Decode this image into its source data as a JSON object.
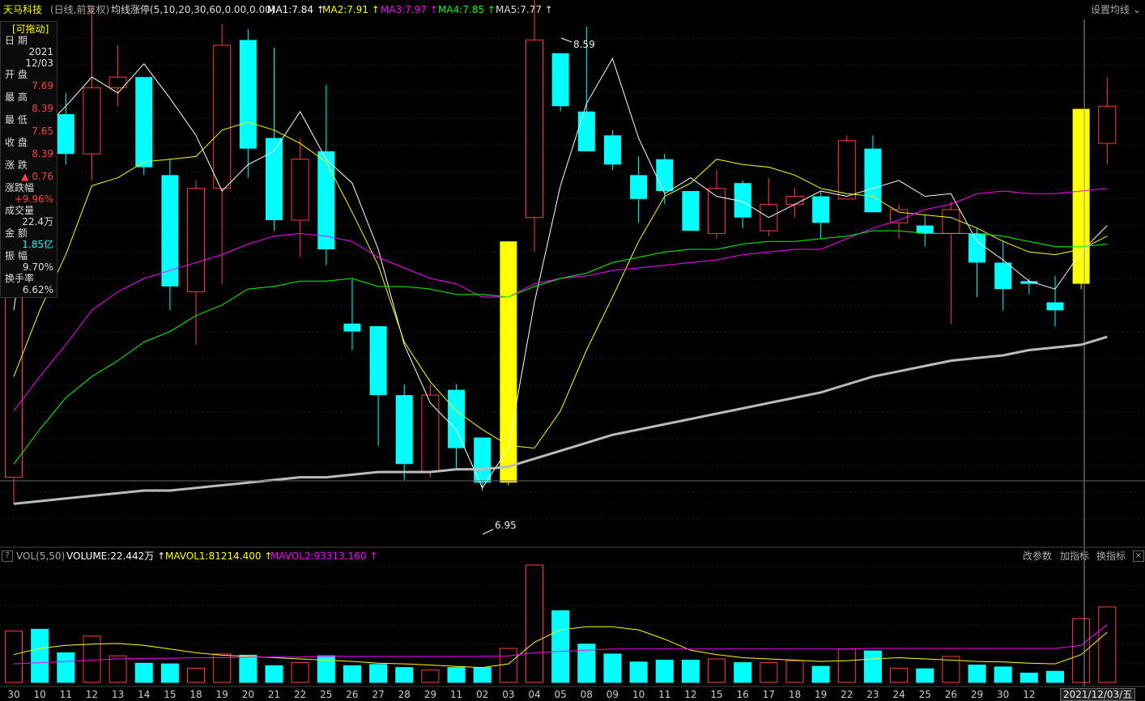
{
  "header": {
    "stock_name": "天马科技",
    "mode": "(日线,前复权)",
    "indicator_name": "均线涨停(5,10,20,30,60,0.00,0.00)",
    "ma1": "MA1:7.84",
    "ma2": "MA2:7.91",
    "ma3": "MA3:7.97",
    "ma4": "MA4:7.85",
    "ma5": "MA5:7.77",
    "settings_label": "设置均线"
  },
  "info_panel": {
    "drag_label": "[可拖动]",
    "date_label": "日 期",
    "year": "2021",
    "date": "12/03",
    "open_label": "开 盘",
    "open": "7.69",
    "high_label": "最 高",
    "high": "8.39",
    "low_label": "最 低",
    "low": "7.65",
    "close_label": "收 盘",
    "close": "8.39",
    "change_label": "涨 跌",
    "change": "▲ 0.76",
    "pct_label": "涨跌幅",
    "pct": "+9.96%",
    "volume_label": "成交量",
    "volume": "22.4万",
    "amount_label": "金 额",
    "amount": "1.85亿",
    "amplitude_label": "振 幅",
    "amplitude": "9.70%",
    "turnover_label": "换手率",
    "turnover": "6.62%"
  },
  "annotations": {
    "high_label": "8.59",
    "low_label": "6.95"
  },
  "volume_panel": {
    "help": "?",
    "name": "VOL(5,50)",
    "volume": "VOLUME:22.442万",
    "mavol1": "MAVOL1:81214.400",
    "mavol2": "MAVOL2:93313.160",
    "buttons": [
      "改参数",
      "加指标",
      "换指标"
    ]
  },
  "x_axis": {
    "labels": [
      "30",
      "10",
      "11",
      "12",
      "13",
      "14",
      "15",
      "18",
      "19",
      "20",
      "21",
      "22",
      "25",
      "26",
      "27",
      "28",
      "29",
      "11",
      "02",
      "03",
      "04",
      "05",
      "08",
      "09",
      "10",
      "11",
      "12",
      "15",
      "16",
      "17",
      "18",
      "19",
      "22",
      "23",
      "24",
      "25",
      "26",
      "29",
      "30",
      "12"
    ],
    "cursor_date": "2021/12/03/五"
  },
  "colors": {
    "up": "#ff3b3b",
    "down": "#00ffff",
    "limit_up": "#ffff00",
    "ma1": "#ffffff",
    "ma2": "#ffff00",
    "ma3": "#ff00ff",
    "ma4": "#00ff00",
    "ma5": "#bbbbbb",
    "background": "#000000"
  },
  "chart_data": {
    "type": "candlestick",
    "candles": [
      {
        "d": "30",
        "o": 7.0,
        "h": 8.6,
        "l": 6.9,
        "c": 8.55,
        "v": 83000,
        "lim": false
      },
      {
        "d": "10",
        "o": 8.5,
        "h": 8.52,
        "l": 8.2,
        "c": 8.3,
        "v": 86000,
        "lim": false
      },
      {
        "d": "11",
        "o": 8.37,
        "h": 8.45,
        "l": 8.18,
        "c": 8.22,
        "v": 48000,
        "lim": false
      },
      {
        "d": "12",
        "o": 8.22,
        "h": 8.78,
        "l": 8.12,
        "c": 8.47,
        "v": 75000,
        "lim": false
      },
      {
        "d": "13",
        "o": 8.47,
        "h": 8.63,
        "l": 8.4,
        "c": 8.51,
        "v": 43000,
        "lim": false
      },
      {
        "d": "14",
        "o": 8.51,
        "h": 8.51,
        "l": 8.14,
        "c": 8.17,
        "v": 31000,
        "lim": false
      },
      {
        "d": "15",
        "o": 8.14,
        "h": 8.2,
        "l": 7.63,
        "c": 7.72,
        "v": 30000,
        "lim": false
      },
      {
        "d": "18",
        "o": 7.7,
        "h": 8.12,
        "l": 7.5,
        "c": 8.09,
        "v": 23000,
        "lim": false
      },
      {
        "d": "19",
        "o": 8.09,
        "h": 8.71,
        "l": 7.73,
        "c": 8.63,
        "v": 46000,
        "lim": false
      },
      {
        "d": "20",
        "o": 8.65,
        "h": 8.69,
        "l": 8.13,
        "c": 8.24,
        "v": 44000,
        "lim": false
      },
      {
        "d": "21",
        "o": 8.28,
        "h": 8.62,
        "l": 7.93,
        "c": 7.97,
        "v": 27000,
        "lim": false
      },
      {
        "d": "22",
        "o": 7.97,
        "h": 8.28,
        "l": 7.83,
        "c": 8.2,
        "v": 32000,
        "lim": false
      },
      {
        "d": "25",
        "o": 8.23,
        "h": 8.48,
        "l": 7.8,
        "c": 7.86,
        "v": 43000,
        "lim": false
      },
      {
        "d": "26",
        "o": 7.58,
        "h": 7.75,
        "l": 7.48,
        "c": 7.55,
        "v": 27000,
        "lim": false
      },
      {
        "d": "27",
        "o": 7.57,
        "h": 7.57,
        "l": 7.12,
        "c": 7.31,
        "v": 29000,
        "lim": false
      },
      {
        "d": "28",
        "o": 7.31,
        "h": 7.35,
        "l": 6.99,
        "c": 7.05,
        "v": 24000,
        "lim": false
      },
      {
        "d": "29",
        "o": 7.02,
        "h": 7.35,
        "l": 7.0,
        "c": 7.31,
        "v": 20000,
        "lim": false
      },
      {
        "d": "11",
        "o": 7.33,
        "h": 7.35,
        "l": 7.03,
        "c": 7.11,
        "v": 24000,
        "lim": false
      },
      {
        "d": "02",
        "o": 7.15,
        "h": 7.15,
        "l": 6.95,
        "c": 6.98,
        "v": 24000,
        "lim": false
      },
      {
        "d": "03",
        "o": 6.98,
        "h": 7.89,
        "l": 6.97,
        "c": 7.89,
        "v": 55000,
        "lim": true
      },
      {
        "d": "04",
        "o": 7.98,
        "h": 8.83,
        "l": 7.85,
        "c": 8.65,
        "v": 190000,
        "lim": false
      },
      {
        "d": "05",
        "o": 8.6,
        "h": 8.59,
        "l": 8.38,
        "c": 8.4,
        "v": 116000,
        "lim": false
      },
      {
        "d": "08",
        "o": 8.38,
        "h": 8.7,
        "l": 8.23,
        "c": 8.23,
        "v": 62000,
        "lim": false
      },
      {
        "d": "09",
        "o": 8.29,
        "h": 8.31,
        "l": 8.16,
        "c": 8.18,
        "v": 46000,
        "lim": false
      },
      {
        "d": "10",
        "o": 8.14,
        "h": 8.21,
        "l": 7.96,
        "c": 8.05,
        "v": 33000,
        "lim": false
      },
      {
        "d": "11",
        "o": 8.2,
        "h": 8.22,
        "l": 8.03,
        "c": 8.08,
        "v": 36000,
        "lim": false
      },
      {
        "d": "12",
        "o": 8.08,
        "h": 8.08,
        "l": 7.93,
        "c": 7.93,
        "v": 36000,
        "lim": false
      },
      {
        "d": "15",
        "o": 7.92,
        "h": 8.16,
        "l": 7.9,
        "c": 8.09,
        "v": 38000,
        "lim": false
      },
      {
        "d": "16",
        "o": 8.11,
        "h": 8.12,
        "l": 7.94,
        "c": 7.98,
        "v": 32000,
        "lim": false
      },
      {
        "d": "17",
        "o": 7.93,
        "h": 8.13,
        "l": 7.91,
        "c": 8.03,
        "v": 32000,
        "lim": false
      },
      {
        "d": "18",
        "o": 8.03,
        "h": 8.09,
        "l": 7.98,
        "c": 8.06,
        "v": 35000,
        "lim": false
      },
      {
        "d": "19",
        "o": 8.06,
        "h": 8.08,
        "l": 7.9,
        "c": 7.96,
        "v": 26000,
        "lim": false
      },
      {
        "d": "22",
        "o": 8.05,
        "h": 8.29,
        "l": 8.05,
        "c": 8.27,
        "v": 54000,
        "lim": false
      },
      {
        "d": "23",
        "o": 8.24,
        "h": 8.29,
        "l": 8.0,
        "c": 8.0,
        "v": 51000,
        "lim": false
      },
      {
        "d": "24",
        "o": 7.96,
        "h": 8.03,
        "l": 7.9,
        "c": 8.01,
        "v": 23000,
        "lim": false
      },
      {
        "d": "25",
        "o": 7.95,
        "h": 7.99,
        "l": 7.87,
        "c": 7.92,
        "v": 22000,
        "lim": false
      },
      {
        "d": "26",
        "o": 7.92,
        "h": 8.04,
        "l": 7.58,
        "c": 8.01,
        "v": 42000,
        "lim": false
      },
      {
        "d": "29",
        "o": 7.92,
        "h": 7.94,
        "l": 7.68,
        "c": 7.81,
        "v": 28000,
        "lim": false
      },
      {
        "d": "30",
        "o": 7.81,
        "h": 7.89,
        "l": 7.63,
        "c": 7.71,
        "v": 25000,
        "lim": false
      },
      {
        "d": "12",
        "o": 7.74,
        "h": 7.75,
        "l": 7.69,
        "c": 7.73,
        "v": 15000,
        "lim": false
      },
      {
        "d": "01",
        "o": 7.66,
        "h": 7.76,
        "l": 7.57,
        "c": 7.63,
        "v": 18000,
        "lim": false
      },
      {
        "d": "02",
        "o": 7.73,
        "h": 8.39,
        "l": 7.71,
        "c": 8.39,
        "v": 103000,
        "lim": true
      },
      {
        "d": "03",
        "o": 8.26,
        "h": 8.51,
        "l": 8.18,
        "c": 8.4,
        "v": 122000,
        "lim": false
      }
    ],
    "ma_series": [
      {
        "name": "MA1",
        "values": [
          7.63,
          8.3,
          8.4,
          8.51,
          8.45,
          8.56,
          8.43,
          8.29,
          8.08,
          8.18,
          8.23,
          8.38,
          8.2,
          8.11,
          7.86,
          7.5,
          7.28,
          7.18,
          6.96,
          7.11,
          7.66,
          8.1,
          8.41,
          8.58,
          8.28,
          8.07,
          8.13,
          8.06,
          8.04,
          7.98,
          8.03,
          8.08,
          8.06,
          8.09,
          8.12,
          8.06,
          8.07,
          7.89,
          7.82,
          7.74,
          7.71,
          7.85,
          7.95
        ]
      },
      {
        "name": "MA2",
        "values": [
          7.38,
          7.63,
          7.84,
          8.1,
          8.13,
          8.19,
          8.2,
          8.21,
          8.31,
          8.34,
          8.31,
          8.26,
          8.19,
          8.0,
          7.8,
          7.51,
          7.36,
          7.25,
          7.18,
          7.12,
          7.11,
          7.25,
          7.48,
          7.68,
          7.89,
          8.06,
          8.11,
          8.2,
          8.18,
          8.17,
          8.14,
          8.09,
          8.07,
          8.06,
          8.0,
          7.99,
          7.98,
          7.94,
          7.89,
          7.85,
          7.84,
          7.86,
          7.91
        ]
      },
      {
        "name": "MA3",
        "values": [
          7.25,
          7.38,
          7.5,
          7.63,
          7.7,
          7.75,
          7.78,
          7.81,
          7.84,
          7.88,
          7.91,
          7.92,
          7.91,
          7.89,
          7.83,
          7.79,
          7.75,
          7.73,
          7.68,
          7.68,
          7.73,
          7.75,
          7.76,
          7.78,
          7.79,
          7.8,
          7.81,
          7.82,
          7.84,
          7.85,
          7.86,
          7.86,
          7.9,
          7.94,
          7.97,
          8.01,
          8.03,
          8.07,
          8.08,
          8.07,
          8.07,
          8.08,
          8.09
        ]
      },
      {
        "name": "MA4",
        "values": [
          7.05,
          7.18,
          7.3,
          7.38,
          7.44,
          7.51,
          7.55,
          7.61,
          7.65,
          7.71,
          7.72,
          7.74,
          7.74,
          7.75,
          7.72,
          7.72,
          7.71,
          7.69,
          7.69,
          7.68,
          7.72,
          7.75,
          7.77,
          7.81,
          7.83,
          7.85,
          7.86,
          7.86,
          7.88,
          7.89,
          7.89,
          7.9,
          7.91,
          7.93,
          7.93,
          7.92,
          7.92,
          7.92,
          7.91,
          7.89,
          7.87,
          7.87,
          7.88
        ]
      },
      {
        "name": "MA5",
        "values": [
          6.9,
          6.91,
          6.92,
          6.93,
          6.94,
          6.95,
          6.95,
          6.96,
          6.97,
          6.98,
          6.99,
          7.0,
          7.0,
          7.01,
          7.02,
          7.02,
          7.02,
          7.03,
          7.03,
          7.04,
          7.07,
          7.1,
          7.13,
          7.16,
          7.18,
          7.2,
          7.22,
          7.24,
          7.26,
          7.28,
          7.3,
          7.32,
          7.35,
          7.38,
          7.4,
          7.42,
          7.44,
          7.45,
          7.46,
          7.48,
          7.49,
          7.5,
          7.53
        ]
      }
    ],
    "vol_ma": [
      {
        "name": "MAVOL1",
        "values": [
          45000,
          55000,
          60000,
          62000,
          63000,
          60000,
          54000,
          48000,
          44000,
          42000,
          40000,
          38000,
          36000,
          34000,
          31000,
          30000,
          28000,
          26000,
          24000,
          30000,
          65000,
          85000,
          90000,
          90000,
          85000,
          70000,
          52000,
          45000,
          40000,
          38000,
          36000,
          34000,
          35000,
          38000,
          40000,
          38000,
          36000,
          34000,
          33000,
          31000,
          30000,
          45000,
          81214
        ]
      },
      {
        "name": "MAVOL2",
        "values": [
          30000,
          32000,
          34000,
          36000,
          38000,
          39000,
          39000,
          40000,
          40000,
          41000,
          41000,
          41000,
          42000,
          42000,
          42000,
          42000,
          42000,
          42000,
          42000,
          43000,
          48000,
          50000,
          52000,
          54000,
          54000,
          54000,
          54000,
          54000,
          54000,
          54000,
          54000,
          54000,
          54000,
          55000,
          55000,
          55000,
          55000,
          55000,
          55000,
          55000,
          55000,
          60000,
          93313
        ]
      }
    ],
    "price_ylim": [
      6.9,
      8.9
    ],
    "volume_ylim": [
      0,
      190000
    ]
  }
}
